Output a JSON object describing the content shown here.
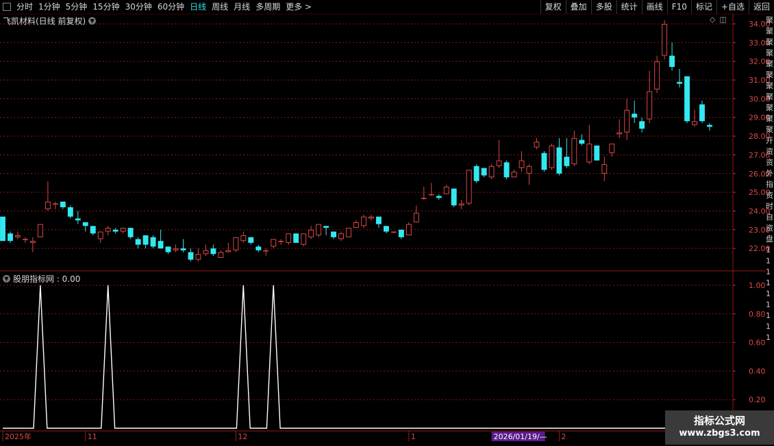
{
  "toolbar": {
    "periods": [
      "分时",
      "1分钟",
      "5分钟",
      "15分钟",
      "30分钟",
      "60分钟",
      "日线",
      "周线",
      "月线",
      "多周期",
      "更多 >"
    ],
    "active_period": "日线",
    "right_buttons": [
      "复权",
      "叠加",
      "多股",
      "统计",
      "画线",
      "F10",
      "标记",
      "+自选",
      "返回"
    ]
  },
  "main_chart": {
    "title": "飞凯材料(日线 前复权)",
    "icons": [
      "diamond-icon",
      "window-icon"
    ]
  },
  "indicator": {
    "title": "股朋指标网 : 0.00"
  },
  "watermark": {
    "line1": "指标公式网",
    "line2": "www.zbgs3.com"
  },
  "date_axis": {
    "labels": [
      "2025年",
      "11",
      "12",
      "1",
      "2"
    ],
    "crosshair_date": "2026/01/19/—"
  },
  "right_column_chars": [
    "聚",
    "聚",
    "聚",
    "聚",
    "聚",
    "聚",
    "聚",
    "聚",
    "聚",
    "聚",
    "聚",
    "开",
    "资",
    "资",
    "外",
    "指",
    "资",
    "时",
    "自",
    "资",
    "盘",
    "1",
    "1",
    "1",
    "1",
    "1",
    "1",
    "1",
    "1",
    "1"
  ],
  "colors": {
    "up": "#e04848",
    "down": "#33e8f0",
    "grid": "#8b1a1a",
    "signal_line": "#ffffff",
    "accent": "#33ddee"
  },
  "chart_data": [
    {
      "type": "candlestick",
      "title": "飞凯材料(日线 前复权)",
      "ylim": [
        20.8,
        34.4
      ],
      "y_ticks": [
        22.0,
        23.0,
        24.0,
        25.0,
        26.0,
        27.0,
        28.0,
        29.0,
        30.0,
        31.0,
        32.0,
        33.0,
        34.0
      ],
      "y_tick_labels": [
        "22.00",
        "23.00",
        "24.00",
        "25.00",
        "26.00",
        "27.00",
        "28.00",
        "29.00",
        "30.00",
        "31.00",
        "32.00",
        "33.00",
        "34.00"
      ],
      "candles": [
        [
          23.7,
          22.4,
          23.7,
          22.4
        ],
        [
          22.8,
          22.4,
          22.9,
          22.3
        ],
        [
          22.6,
          22.7,
          22.9,
          22.5
        ],
        [
          22.5,
          22.5,
          22.6,
          22.3
        ],
        [
          22.3,
          22.4,
          22.6,
          21.8
        ],
        [
          22.6,
          23.3,
          23.3,
          22.6
        ],
        [
          24.1,
          24.5,
          25.6,
          24.0
        ],
        [
          24.4,
          24.4,
          24.5,
          24.1
        ],
        [
          24.5,
          24.2,
          24.5,
          24.1
        ],
        [
          24.2,
          23.7,
          24.3,
          23.6
        ],
        [
          23.6,
          23.5,
          24.0,
          23.3
        ],
        [
          23.4,
          23.2,
          23.4,
          22.9
        ],
        [
          23.2,
          22.8,
          23.2,
          22.7
        ],
        [
          22.5,
          22.9,
          22.9,
          22.3
        ],
        [
          22.9,
          23.1,
          23.2,
          22.7
        ],
        [
          23.0,
          22.9,
          23.1,
          22.8
        ],
        [
          22.9,
          23.1,
          23.1,
          22.8
        ],
        [
          23.1,
          22.6,
          23.1,
          22.5
        ],
        [
          22.5,
          22.2,
          22.6,
          22.0
        ],
        [
          22.7,
          22.2,
          22.7,
          22.0
        ],
        [
          22.6,
          22.1,
          22.7,
          22.0
        ],
        [
          22.4,
          22.0,
          23.0,
          22.0
        ],
        [
          22.1,
          21.8,
          22.1,
          21.7
        ],
        [
          21.9,
          22.0,
          22.2,
          21.8
        ],
        [
          22.0,
          21.9,
          22.5,
          21.8
        ],
        [
          21.8,
          21.4,
          22.0,
          21.3
        ],
        [
          21.4,
          21.7,
          22.0,
          21.3
        ],
        [
          21.7,
          21.9,
          22.2,
          21.6
        ],
        [
          22.0,
          21.7,
          22.2,
          21.6
        ],
        [
          21.5,
          21.8,
          21.9,
          21.5
        ],
        [
          21.8,
          21.9,
          22.3,
          21.8
        ],
        [
          21.9,
          22.6,
          22.6,
          21.8
        ],
        [
          22.4,
          22.7,
          22.9,
          22.3
        ],
        [
          22.6,
          22.3,
          22.6,
          22.2
        ],
        [
          22.1,
          21.9,
          22.2,
          21.8
        ],
        [
          21.9,
          21.9,
          22.0,
          21.6
        ],
        [
          22.1,
          22.5,
          22.5,
          22.0
        ],
        [
          22.4,
          22.4,
          22.5,
          22.2
        ],
        [
          22.3,
          22.8,
          22.8,
          22.2
        ],
        [
          22.8,
          22.3,
          22.8,
          22.3
        ],
        [
          22.2,
          22.8,
          22.8,
          22.1
        ],
        [
          22.6,
          23.0,
          23.2,
          22.5
        ],
        [
          22.7,
          23.3,
          23.3,
          22.6
        ],
        [
          23.2,
          23.1,
          23.2,
          22.7
        ],
        [
          22.9,
          22.6,
          22.9,
          22.5
        ],
        [
          22.5,
          22.8,
          22.9,
          22.4
        ],
        [
          22.6,
          23.1,
          23.1,
          22.6
        ],
        [
          23.1,
          23.4,
          23.5,
          23.1
        ],
        [
          23.2,
          23.7,
          23.8,
          23.1
        ],
        [
          23.6,
          23.7,
          23.8,
          23.5
        ],
        [
          23.7,
          23.3,
          23.7,
          23.1
        ],
        [
          23.2,
          22.9,
          23.2,
          22.8
        ],
        [
          22.9,
          22.9,
          22.9,
          22.8
        ],
        [
          23.0,
          22.6,
          23.0,
          22.5
        ],
        [
          22.7,
          23.3,
          23.4,
          22.7
        ],
        [
          23.4,
          23.9,
          24.3,
          23.4
        ],
        [
          24.7,
          24.7,
          25.3,
          24.6
        ],
        [
          24.9,
          24.9,
          25.5,
          24.8
        ],
        [
          24.8,
          24.7,
          24.9,
          24.6
        ],
        [
          24.9,
          25.3,
          25.4,
          24.9
        ],
        [
          25.2,
          24.3,
          25.2,
          24.2
        ],
        [
          24.3,
          24.4,
          24.6,
          24.1
        ],
        [
          24.4,
          26.2,
          26.2,
          24.3
        ],
        [
          26.4,
          25.6,
          26.5,
          25.5
        ],
        [
          26.3,
          25.9,
          26.3,
          25.8
        ],
        [
          25.8,
          26.4,
          26.5,
          25.7
        ],
        [
          26.4,
          26.7,
          27.8,
          26.3
        ],
        [
          26.6,
          25.8,
          26.7,
          25.7
        ],
        [
          25.8,
          26.1,
          26.2,
          25.8
        ],
        [
          26.3,
          26.7,
          27.2,
          26.1
        ],
        [
          26.0,
          26.4,
          26.5,
          25.4
        ],
        [
          27.4,
          27.7,
          27.9,
          27.3
        ],
        [
          27.1,
          26.2,
          27.2,
          26.1
        ],
        [
          26.3,
          27.5,
          27.6,
          26.2
        ],
        [
          27.4,
          26.0,
          27.9,
          25.9
        ],
        [
          26.9,
          26.4,
          27.9,
          26.3
        ],
        [
          26.5,
          27.9,
          28.3,
          26.4
        ],
        [
          27.8,
          27.6,
          28.1,
          27.5
        ],
        [
          26.6,
          27.6,
          28.6,
          26.5
        ],
        [
          27.5,
          26.7,
          27.5,
          26.7
        ],
        [
          26.0,
          26.5,
          26.9,
          25.6
        ],
        [
          27.1,
          27.6,
          27.6,
          26.9
        ],
        [
          28.1,
          28.2,
          28.9,
          27.9
        ],
        [
          28.2,
          29.4,
          30.0,
          27.8
        ],
        [
          29.2,
          29.0,
          29.9,
          28.7
        ],
        [
          28.8,
          28.4,
          29.0,
          28.2
        ],
        [
          28.9,
          30.4,
          31.5,
          28.7
        ],
        [
          30.5,
          32.0,
          32.3,
          30.3
        ],
        [
          32.3,
          34.0,
          34.2,
          32.1
        ],
        [
          32.3,
          31.7,
          33.0,
          31.5
        ],
        [
          30.9,
          30.8,
          31.6,
          30.6
        ],
        [
          31.2,
          28.8,
          31.2,
          28.7
        ],
        [
          28.6,
          28.8,
          29.4,
          28.5
        ],
        [
          29.7,
          28.8,
          29.9,
          28.7
        ],
        [
          28.6,
          28.5,
          28.7,
          28.3
        ]
      ]
    },
    {
      "type": "line",
      "title": "股朋指标网",
      "ylim": [
        0,
        1.0
      ],
      "y_ticks": [
        0.2,
        0.4,
        0.6,
        0.8,
        1.0
      ],
      "y_tick_labels": [
        "0.20",
        "0.40",
        "0.60",
        "0.80",
        "1.00"
      ],
      "signal_values": [
        0,
        0,
        0,
        0,
        0,
        1,
        0,
        0,
        0,
        0,
        0,
        0,
        0,
        0,
        1,
        0,
        0,
        0,
        0,
        0,
        0,
        0,
        0,
        0,
        0,
        0,
        0,
        0,
        0,
        0,
        0,
        0,
        1,
        0,
        0,
        0,
        1,
        0,
        0,
        0,
        0,
        0,
        0,
        0,
        0,
        0,
        0,
        0,
        0,
        0,
        0,
        0,
        0,
        0,
        0,
        0,
        0,
        0,
        0,
        0,
        0,
        0,
        0,
        0,
        0,
        0,
        0,
        0,
        0,
        0,
        0,
        0,
        0,
        0,
        0,
        0,
        0,
        0,
        0,
        0,
        0,
        0,
        0,
        0,
        0,
        0,
        0,
        0,
        0,
        0,
        0,
        0,
        0,
        0,
        0,
        0
      ]
    }
  ]
}
